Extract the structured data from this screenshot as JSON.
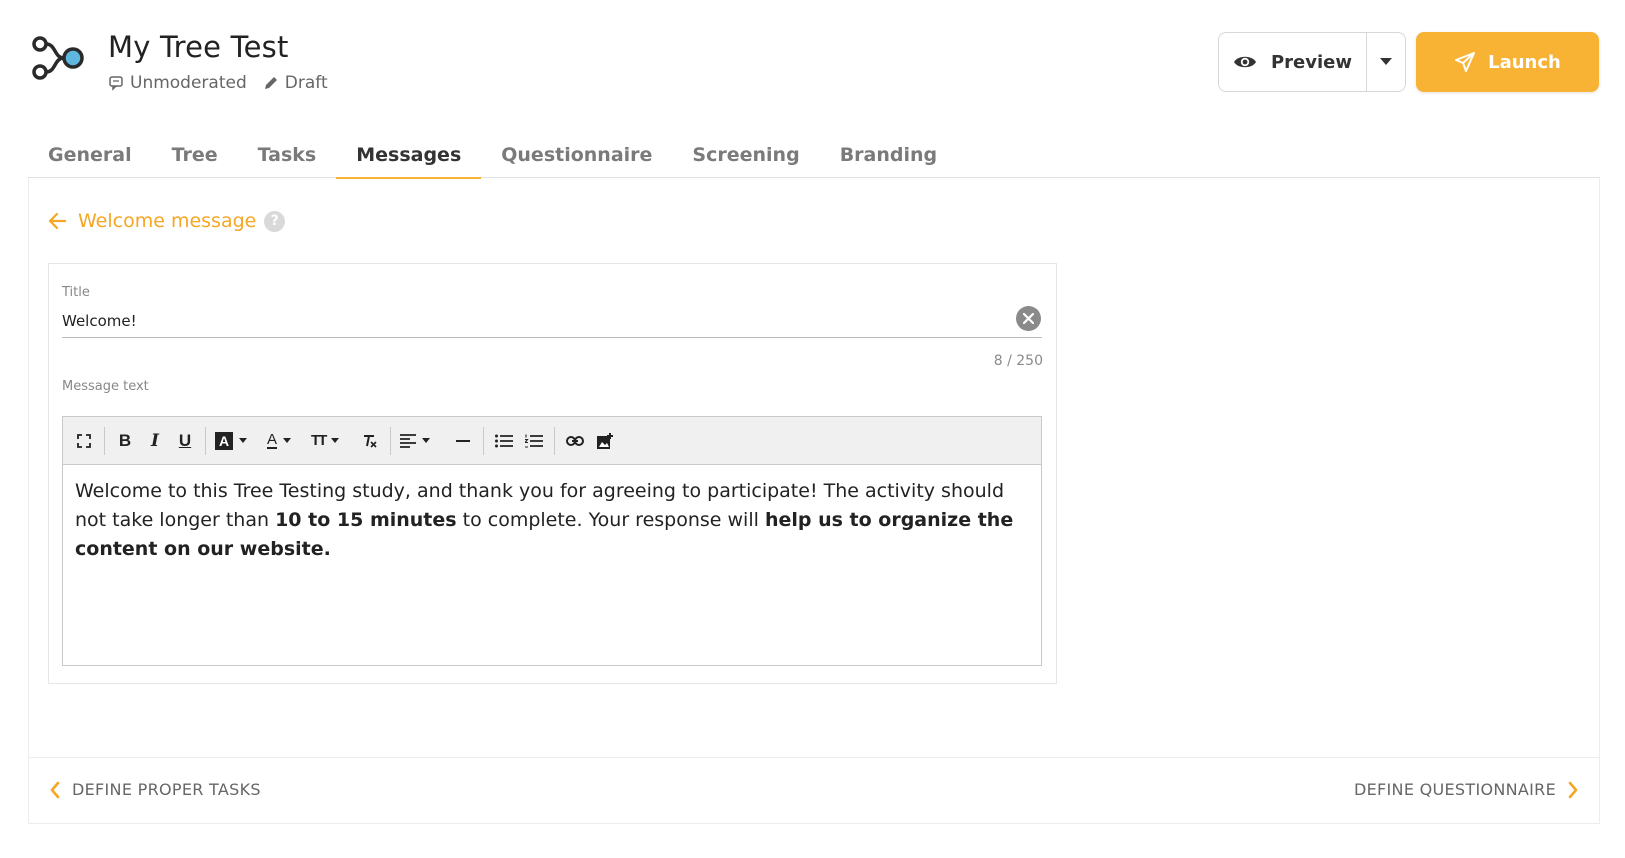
{
  "header": {
    "study_title": "My Tree Test",
    "mode": "Unmoderated",
    "status": "Draft",
    "preview_label": "Preview",
    "launch_label": "Launch",
    "icons": {
      "logo": "tree-logo-icon",
      "mode": "chat-icon",
      "status": "pencil-icon",
      "preview": "eye-icon",
      "launch": "send-icon",
      "dropdown": "caret-down-icon"
    }
  },
  "tabs": [
    {
      "label": "General",
      "active": false
    },
    {
      "label": "Tree",
      "active": false
    },
    {
      "label": "Tasks",
      "active": false
    },
    {
      "label": "Messages",
      "active": true
    },
    {
      "label": "Questionnaire",
      "active": false
    },
    {
      "label": "Screening",
      "active": false
    },
    {
      "label": "Branding",
      "active": false
    }
  ],
  "section": {
    "title": "Welcome message",
    "help": "?"
  },
  "form": {
    "title_label": "Title",
    "title_value": "Welcome!",
    "counter": "8 / 250",
    "message_label": "Message text",
    "message_parts": {
      "p1": "Welcome to this Tree Testing study, and thank you for agreeing to participate! The activity should not take longer than ",
      "b1": "10 to 15 minutes",
      "p2": " to complete. Your response will ",
      "b2": "help us to organize the content on our website."
    }
  },
  "toolbar": {
    "bold": "B",
    "italic": "I",
    "underline": "U",
    "highlight": "A",
    "font_color": "A",
    "font_size": "TT"
  },
  "footer": {
    "prev_label": "DEFINE PROPER TASKS",
    "next_label": "DEFINE QUESTIONNAIRE"
  },
  "colors": {
    "accent": "#f8b234",
    "accent_text": "#f5a623",
    "logo_dot": "#5fb7e0"
  }
}
